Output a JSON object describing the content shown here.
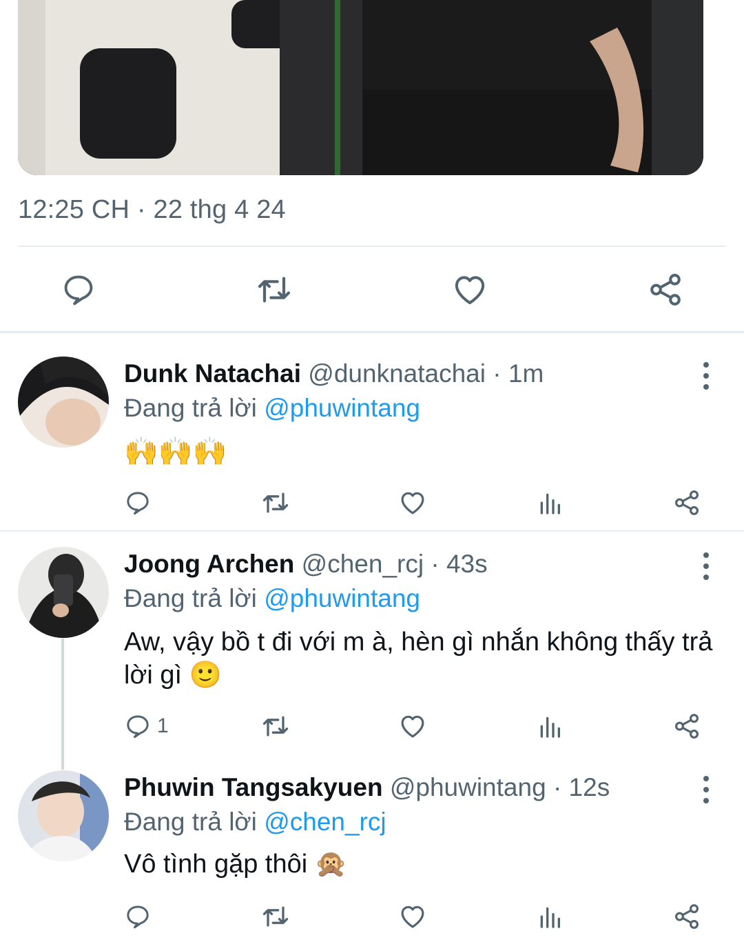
{
  "tweet": {
    "timestamp": "12:25 CH · 22 thg 4 24"
  },
  "colors": {
    "accent": "#1d9bf0",
    "muted": "#536471",
    "divider": "#e6ecf0"
  },
  "replies": [
    {
      "name": "Dunk Natachai",
      "handle": "@dunknatachai",
      "time": "· 1m",
      "reply_prefix": "Đang trả lời",
      "reply_to": "@phuwintang",
      "text": "🙌🙌🙌",
      "reply_count": ""
    },
    {
      "name": "Joong Archen",
      "handle": "@chen_rcj",
      "time": "· 43s",
      "reply_prefix": "Đang trả lời",
      "reply_to": "@phuwintang",
      "text": "Aw, vậy bồ t đi với m à, hèn gì nhắn không thấy trả lời gì 🙂",
      "reply_count": "1"
    },
    {
      "name": "Phuwin Tangsakyuen",
      "handle": "@phuwintang",
      "time": "· 12s",
      "reply_prefix": "Đang trả lời",
      "reply_to": "@chen_rcj",
      "text": "Vô tình gặp thôi 🙊",
      "reply_count": ""
    }
  ]
}
